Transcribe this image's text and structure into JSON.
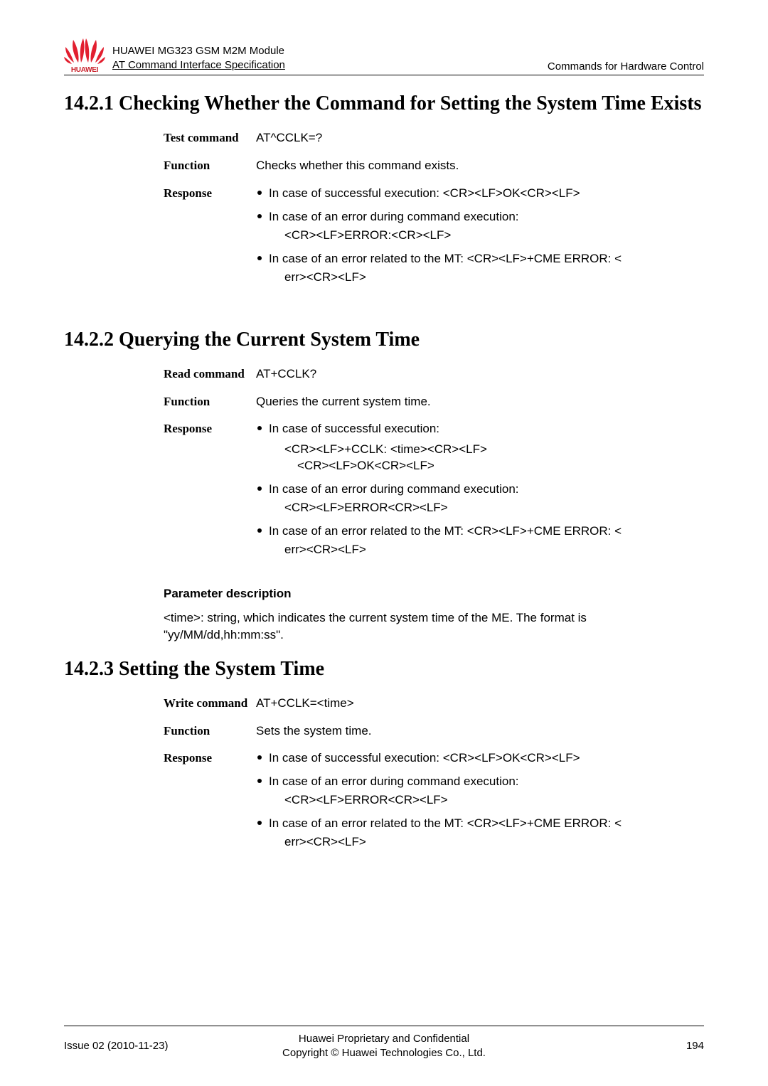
{
  "header": {
    "product": "HUAWEI MG323 GSM M2M Module",
    "doc": "AT Command Interface Specification",
    "chapter": "Commands for Hardware Control",
    "logo_brand": "HUAWEI"
  },
  "sections": [
    {
      "title": "14.2.1 Checking Whether the Command for Setting the System Time Exists",
      "rows": {
        "test_label": "Test command",
        "test_value": "AT^CCLK=?",
        "func_label": "Function",
        "func_value": "Checks whether this command exists.",
        "resp_label": "Response",
        "resp_items": [
          {
            "line": "In case of successful execution: <CR><LF>OK<CR><LF>"
          },
          {
            "line": "In case of an error during command execution: <CR><LF>ERROR:<CR><LF>",
            "break_after": 46
          },
          {
            "line": "In case of an error related to the MT: <CR><LF>+CME ERROR: <err><CR><LF>",
            "break_after": 60
          }
        ]
      }
    },
    {
      "title": "14.2.2 Querying the Current System Time",
      "rows": {
        "read_label": "Read command",
        "read_value": "AT+CCLK?",
        "func_label": "Function",
        "func_value": "Queries the current system time.",
        "resp_label": "Response",
        "resp_items": [
          {
            "line": "In case of successful execution:",
            "sub": "<CR><LF>+CCLK: <time><CR><LF> <CR><LF>OK<CR><LF>"
          },
          {
            "line": "In case of an error during command execution: <CR><LF>ERROR<CR><LF>",
            "break_after": 46
          },
          {
            "line": "In case of an error related to the MT: <CR><LF>+CME ERROR: <err><CR><LF>",
            "break_after": 60
          }
        ]
      },
      "param": {
        "heading": "Parameter description",
        "text": "<time>: string, which indicates the current system time of the ME. The format is \"yy/MM/dd,hh:mm:ss\"."
      }
    },
    {
      "title": "14.2.3 Setting the System Time",
      "rows": {
        "write_label": "Write command",
        "write_value": "AT+CCLK=<time>",
        "func_label": "Function",
        "func_value": "Sets the system time.",
        "resp_label": "Response",
        "resp_items": [
          {
            "line": "In case of successful execution: <CR><LF>OK<CR><LF>"
          },
          {
            "line": "In case of an error during command execution: <CR><LF>ERROR<CR><LF>",
            "break_after": 46
          },
          {
            "line": "In case of an error related to the MT: <CR><LF>+CME ERROR: <err><CR><LF>",
            "break_after": 60
          }
        ]
      }
    }
  ],
  "footer": {
    "issue": "Issue 02 (2010-11-23)",
    "center1": "Huawei Proprietary and Confidential",
    "center2": "Copyright © Huawei Technologies Co., Ltd.",
    "page": "194"
  }
}
